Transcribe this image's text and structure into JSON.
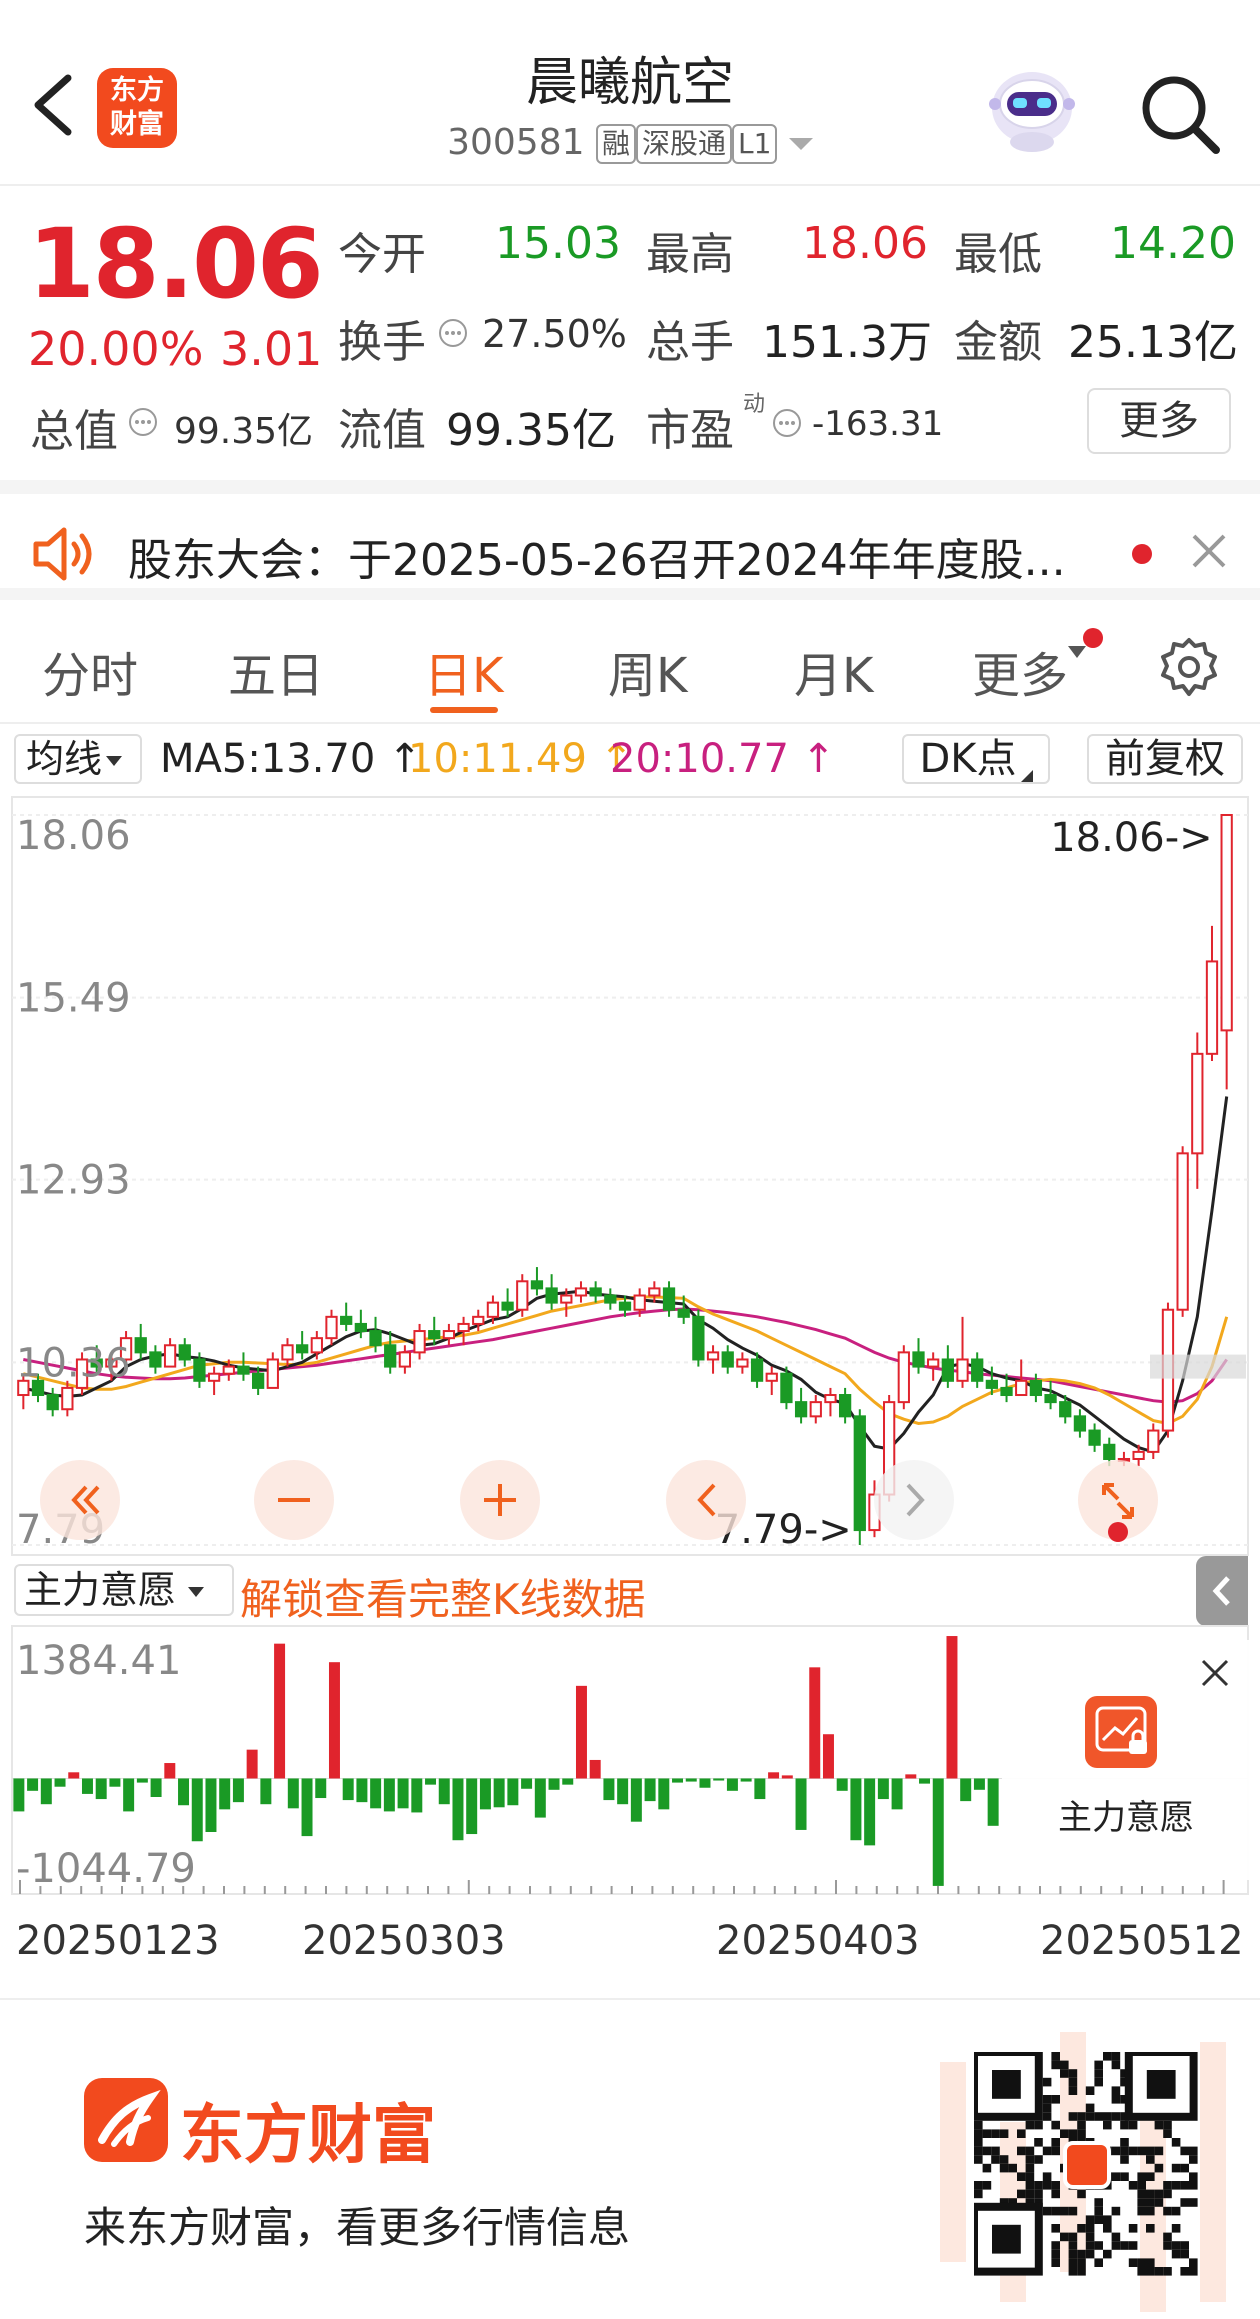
{
  "header": {
    "stock_name": "晨曦航空",
    "stock_code": "300581",
    "tags": [
      "融",
      "深股通",
      "L1"
    ],
    "logo_text": [
      "东方",
      "财富"
    ]
  },
  "quote": {
    "price": "18.06",
    "change_pct": "20.00%",
    "change": "3.01",
    "total_value_label": "总值",
    "total_value": "99.35亿",
    "fields": [
      {
        "label": "今开",
        "value": "15.03",
        "color": "#1a9a25"
      },
      {
        "label": "最高",
        "value": "18.06",
        "color": "#e0242d"
      },
      {
        "label": "最低",
        "value": "14.20",
        "color": "#1a9a25"
      },
      {
        "label": "换手",
        "value": "27.50%",
        "color": "#333333"
      },
      {
        "label": "总手",
        "value": "151.3万",
        "color": "#222222"
      },
      {
        "label": "金额",
        "value": "25.13亿",
        "color": "#222222"
      },
      {
        "label": "流值",
        "value": "99.35亿",
        "color": "#222222"
      },
      {
        "label": "市盈",
        "value": "-163.31",
        "color": "#333333",
        "superscript": "动"
      }
    ],
    "more_label": "更多"
  },
  "notice": {
    "text": "股东大会：于2025-05-26召开2024年年度股..."
  },
  "tabs": [
    "分时",
    "五日",
    "日K",
    "周K",
    "月K",
    "更多"
  ],
  "ma_row": {
    "select_label": "均线",
    "ma5": "MA5:13.70",
    "ma10": "10:11.49",
    "ma20": "20:10.77",
    "arrow": "↑",
    "dk_label": "DK点",
    "adjust_label": "前复权"
  },
  "colors": {
    "up": "#e0242d",
    "down": "#1a9a25",
    "ma5": "#222222",
    "ma10": "#f2a81d",
    "ma20": "#c8207f",
    "accent": "#f0611e"
  },
  "chart_data": [
    {
      "type": "candlestick",
      "y_ticks": [
        "18.06",
        "15.49",
        "12.93",
        "10.36",
        "7.79"
      ],
      "ylim": [
        7.79,
        18.06
      ],
      "max_label": "18.06->",
      "min_label": "7.79->",
      "ohlc": [
        [
          9.9,
          10.2,
          9.7,
          10.1
        ],
        [
          10.1,
          10.2,
          9.8,
          9.9
        ],
        [
          9.9,
          10.0,
          9.6,
          9.7
        ],
        [
          9.7,
          10.1,
          9.6,
          10.0
        ],
        [
          10.0,
          10.5,
          9.9,
          10.4
        ],
        [
          10.4,
          10.6,
          10.2,
          10.3
        ],
        [
          10.3,
          10.5,
          10.1,
          10.4
        ],
        [
          10.4,
          10.8,
          10.3,
          10.7
        ],
        [
          10.7,
          10.9,
          10.4,
          10.5
        ],
        [
          10.5,
          10.6,
          10.2,
          10.3
        ],
        [
          10.3,
          10.7,
          10.3,
          10.6
        ],
        [
          10.6,
          10.7,
          10.3,
          10.4
        ],
        [
          10.4,
          10.5,
          10.0,
          10.1
        ],
        [
          10.1,
          10.3,
          9.9,
          10.2
        ],
        [
          10.2,
          10.4,
          10.1,
          10.3
        ],
        [
          10.3,
          10.5,
          10.1,
          10.2
        ],
        [
          10.2,
          10.3,
          9.9,
          10.0
        ],
        [
          10.0,
          10.5,
          10.0,
          10.4
        ],
        [
          10.4,
          10.7,
          10.3,
          10.6
        ],
        [
          10.6,
          10.8,
          10.4,
          10.5
        ],
        [
          10.5,
          10.8,
          10.4,
          10.7
        ],
        [
          10.7,
          11.1,
          10.6,
          11.0
        ],
        [
          11.0,
          11.2,
          10.8,
          10.9
        ],
        [
          10.9,
          11.1,
          10.7,
          10.8
        ],
        [
          10.8,
          11.0,
          10.5,
          10.6
        ],
        [
          10.6,
          10.8,
          10.2,
          10.3
        ],
        [
          10.3,
          10.6,
          10.2,
          10.5
        ],
        [
          10.5,
          10.9,
          10.4,
          10.8
        ],
        [
          10.8,
          11.0,
          10.6,
          10.7
        ],
        [
          10.7,
          10.9,
          10.6,
          10.8
        ],
        [
          10.8,
          11.0,
          10.6,
          10.9
        ],
        [
          10.9,
          11.1,
          10.8,
          11.0
        ],
        [
          11.0,
          11.3,
          10.9,
          11.2
        ],
        [
          11.2,
          11.4,
          11.0,
          11.1
        ],
        [
          11.1,
          11.6,
          11.0,
          11.5
        ],
        [
          11.5,
          11.7,
          11.3,
          11.4
        ],
        [
          11.4,
          11.6,
          11.1,
          11.2
        ],
        [
          11.2,
          11.4,
          11.0,
          11.3
        ],
        [
          11.3,
          11.5,
          11.2,
          11.4
        ],
        [
          11.4,
          11.5,
          11.2,
          11.3
        ],
        [
          11.3,
          11.4,
          11.1,
          11.2
        ],
        [
          11.2,
          11.3,
          11.0,
          11.1
        ],
        [
          11.1,
          11.4,
          11.0,
          11.3
        ],
        [
          11.3,
          11.5,
          11.2,
          11.4
        ],
        [
          11.4,
          11.5,
          11.0,
          11.1
        ],
        [
          11.1,
          11.3,
          10.9,
          11.0
        ],
        [
          11.0,
          11.1,
          10.3,
          10.4
        ],
        [
          10.4,
          10.6,
          10.2,
          10.5
        ],
        [
          10.5,
          10.6,
          10.2,
          10.3
        ],
        [
          10.3,
          10.5,
          10.2,
          10.4
        ],
        [
          10.4,
          10.5,
          10.0,
          10.1
        ],
        [
          10.1,
          10.3,
          9.9,
          10.2
        ],
        [
          10.2,
          10.3,
          9.7,
          9.8
        ],
        [
          9.8,
          10.0,
          9.5,
          9.6
        ],
        [
          9.6,
          9.9,
          9.5,
          9.8
        ],
        [
          9.8,
          10.0,
          9.6,
          9.9
        ],
        [
          9.9,
          10.0,
          9.5,
          9.6
        ],
        [
          9.6,
          9.7,
          7.79,
          8.0
        ],
        [
          8.0,
          8.7,
          7.9,
          8.5
        ],
        [
          8.5,
          9.9,
          8.4,
          9.8
        ],
        [
          9.8,
          10.6,
          9.7,
          10.5
        ],
        [
          10.5,
          10.7,
          10.2,
          10.3
        ],
        [
          10.3,
          10.5,
          10.1,
          10.4
        ],
        [
          10.4,
          10.6,
          10.0,
          10.1
        ],
        [
          10.1,
          11.0,
          10.0,
          10.4
        ],
        [
          10.4,
          10.5,
          10.0,
          10.1
        ],
        [
          10.1,
          10.3,
          9.9,
          10.0
        ],
        [
          10.0,
          10.2,
          9.8,
          9.9
        ],
        [
          9.9,
          10.4,
          9.9,
          10.1
        ],
        [
          10.1,
          10.2,
          9.8,
          9.9
        ],
        [
          9.9,
          10.1,
          9.7,
          9.8
        ],
        [
          9.8,
          9.9,
          9.5,
          9.6
        ],
        [
          9.6,
          9.7,
          9.3,
          9.4
        ],
        [
          9.4,
          9.5,
          9.1,
          9.2
        ],
        [
          9.2,
          9.3,
          8.9,
          9.0
        ],
        [
          9.0,
          9.1,
          8.9,
          9.0
        ],
        [
          9.0,
          9.2,
          8.9,
          9.1
        ],
        [
          9.1,
          9.5,
          9.0,
          9.4
        ],
        [
          9.4,
          11.2,
          9.3,
          11.1
        ],
        [
          11.1,
          13.4,
          11.0,
          13.3
        ],
        [
          13.3,
          15.0,
          12.8,
          14.7
        ],
        [
          14.7,
          16.5,
          14.6,
          16.0
        ],
        [
          15.03,
          18.06,
          14.2,
          18.06
        ]
      ],
      "ma5": [
        10.0,
        9.95,
        9.9,
        9.88,
        9.9,
        10.0,
        10.1,
        10.3,
        10.4,
        10.45,
        10.48,
        10.44,
        10.42,
        10.38,
        10.32,
        10.28,
        10.26,
        10.24,
        10.3,
        10.36,
        10.48,
        10.6,
        10.72,
        10.8,
        10.82,
        10.76,
        10.68,
        10.6,
        10.62,
        10.7,
        10.8,
        10.88,
        10.96,
        11.0,
        11.12,
        11.26,
        11.32,
        11.34,
        11.36,
        11.32,
        11.3,
        11.28,
        11.24,
        11.22,
        11.2,
        11.18,
        10.96,
        10.84,
        10.68,
        10.56,
        10.46,
        10.32,
        10.24,
        10.12,
        9.94,
        9.84,
        9.78,
        9.46,
        9.18,
        9.14,
        9.36,
        9.66,
        9.9,
        10.3,
        10.34,
        10.3,
        10.2,
        10.14,
        10.1,
        10.0,
        9.96,
        9.86,
        9.76,
        9.6,
        9.44,
        9.28,
        9.16,
        9.1,
        9.4,
        10.1,
        11.0,
        12.5,
        14.1
      ],
      "ma10": [
        10.2,
        10.15,
        10.1,
        10.05,
        10.0,
        9.98,
        9.98,
        10.02,
        10.08,
        10.14,
        10.2,
        10.26,
        10.32,
        10.34,
        10.36,
        10.36,
        10.35,
        10.34,
        10.33,
        10.33,
        10.36,
        10.42,
        10.48,
        10.54,
        10.6,
        10.64,
        10.66,
        10.68,
        10.7,
        10.72,
        10.74,
        10.78,
        10.84,
        10.9,
        10.96,
        11.02,
        11.08,
        11.12,
        11.16,
        11.2,
        11.24,
        11.26,
        11.28,
        11.28,
        11.27,
        11.26,
        11.14,
        11.04,
        10.96,
        10.88,
        10.8,
        10.7,
        10.6,
        10.5,
        10.4,
        10.3,
        10.2,
        9.98,
        9.8,
        9.64,
        9.56,
        9.5,
        9.52,
        9.6,
        9.74,
        9.84,
        9.94,
        10.0,
        10.06,
        10.1,
        10.12,
        10.1,
        10.06,
        10.0,
        9.9,
        9.78,
        9.66,
        9.54,
        9.5,
        9.6,
        9.84,
        10.3,
        11.0
      ],
      "ma20": [
        10.4,
        10.36,
        10.32,
        10.28,
        10.24,
        10.2,
        10.17,
        10.15,
        10.14,
        10.13,
        10.13,
        10.14,
        10.16,
        10.18,
        10.2,
        10.22,
        10.24,
        10.26,
        10.28,
        10.3,
        10.32,
        10.35,
        10.38,
        10.41,
        10.44,
        10.47,
        10.5,
        10.53,
        10.56,
        10.59,
        10.62,
        10.65,
        10.68,
        10.72,
        10.76,
        10.8,
        10.84,
        10.88,
        10.92,
        10.96,
        11.0,
        11.03,
        11.06,
        11.08,
        11.1,
        11.11,
        11.1,
        11.08,
        11.06,
        11.03,
        11.0,
        10.96,
        10.92,
        10.87,
        10.82,
        10.76,
        10.7,
        10.6,
        10.5,
        10.42,
        10.36,
        10.32,
        10.28,
        10.25,
        10.23,
        10.2,
        10.18,
        10.16,
        10.14,
        10.12,
        10.1,
        10.06,
        10.02,
        9.98,
        9.94,
        9.9,
        9.86,
        9.82,
        9.8,
        9.82,
        9.92,
        10.1,
        10.4
      ]
    },
    {
      "type": "bar",
      "title": "主力意愿",
      "y_ticks": [
        "1384.41",
        "-1044.79"
      ],
      "ylim": [
        -1044.79,
        1384.41
      ],
      "values": [
        -320,
        -120,
        -250,
        -80,
        60,
        -150,
        -200,
        -80,
        -320,
        -40,
        -180,
        150,
        -260,
        -610,
        -520,
        -300,
        -230,
        280,
        -250,
        1310,
        -290,
        -560,
        -190,
        1130,
        -210,
        -230,
        -290,
        -320,
        -290,
        -330,
        -60,
        -250,
        -600,
        -540,
        -300,
        -280,
        -260,
        -100,
        -380,
        -110,
        -60,
        900,
        180,
        -210,
        -250,
        -420,
        -220,
        -300,
        -40,
        -30,
        -90,
        -20,
        -120,
        -30,
        -200,
        60,
        30,
        -500,
        1080,
        430,
        -120,
        -600,
        -650,
        -200,
        -300,
        40,
        -50,
        -1044,
        1384,
        -220,
        -110,
        -460
      ]
    }
  ],
  "indicator": {
    "select_label": "主力意愿",
    "unlock_text": "解锁查看完整K线数据",
    "card_label": "主力意愿"
  },
  "dates": [
    "20250123",
    "20250303",
    "20250403",
    "20250512"
  ],
  "footer": {
    "brand": "东方财富",
    "slogan": "来东方财富，看更多行情信息"
  }
}
